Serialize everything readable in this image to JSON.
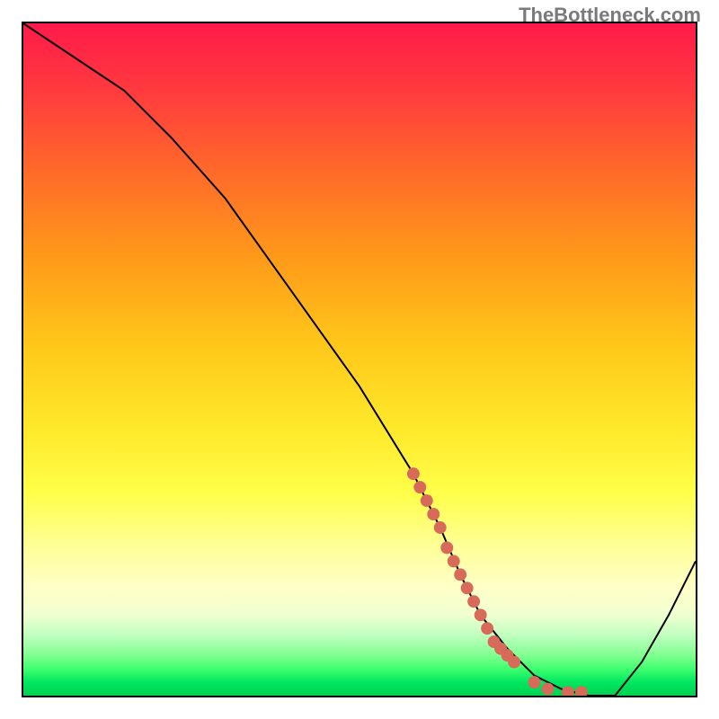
{
  "watermark": "TheBottleneck.com",
  "chart_data": {
    "type": "line",
    "title": "",
    "xlabel": "",
    "ylabel": "",
    "xlim": [
      0,
      100
    ],
    "ylim": [
      0,
      100
    ],
    "series": [
      {
        "name": "bottleneck-curve",
        "x": [
          0,
          15,
          22,
          30,
          40,
          50,
          58,
          62,
          65,
          68,
          72,
          76,
          80,
          84,
          88,
          92,
          96,
          100
        ],
        "values": [
          100,
          90,
          83,
          74,
          60,
          46,
          33,
          25,
          18,
          12,
          7,
          3,
          1,
          0,
          0,
          5,
          12,
          20
        ]
      }
    ],
    "highlight_dots": {
      "name": "highlight-segment",
      "color": "#d86a5a",
      "points": [
        {
          "x": 58,
          "y": 33
        },
        {
          "x": 59,
          "y": 31
        },
        {
          "x": 60,
          "y": 29
        },
        {
          "x": 61,
          "y": 27
        },
        {
          "x": 62,
          "y": 25
        },
        {
          "x": 63,
          "y": 22
        },
        {
          "x": 64,
          "y": 20
        },
        {
          "x": 65,
          "y": 18
        },
        {
          "x": 66,
          "y": 16
        },
        {
          "x": 67,
          "y": 14
        },
        {
          "x": 68,
          "y": 12
        },
        {
          "x": 69,
          "y": 10
        },
        {
          "x": 70,
          "y": 8
        },
        {
          "x": 71,
          "y": 7
        },
        {
          "x": 72,
          "y": 6
        },
        {
          "x": 73,
          "y": 5
        },
        {
          "x": 76,
          "y": 2
        },
        {
          "x": 78,
          "y": 1
        },
        {
          "x": 81,
          "y": 0.5
        },
        {
          "x": 83,
          "y": 0.5
        }
      ]
    },
    "gradient_stops": [
      {
        "pos": 0,
        "color": "#ff1a4a"
      },
      {
        "pos": 50,
        "color": "#ffe82a"
      },
      {
        "pos": 90,
        "color": "#c0ffc0"
      },
      {
        "pos": 100,
        "color": "#00d050"
      }
    ]
  }
}
